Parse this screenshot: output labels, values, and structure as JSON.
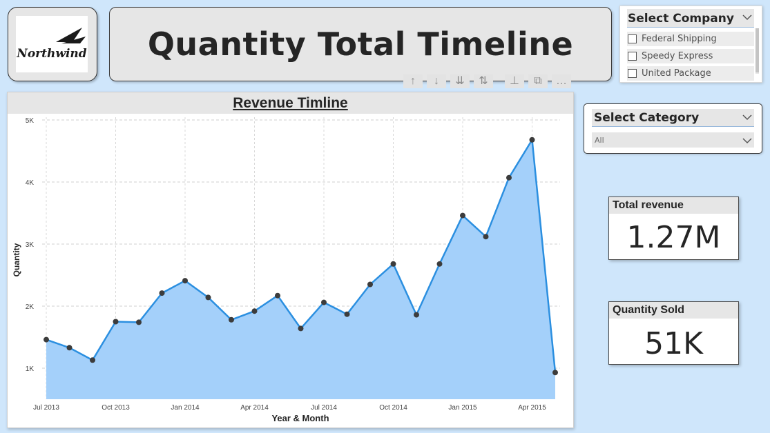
{
  "logo": {
    "text": "Northwind"
  },
  "header": {
    "title": "Quantity Total Timeline"
  },
  "company_slicer": {
    "title": "Select Company",
    "items": [
      {
        "label": "Federal Shipping",
        "checked": false
      },
      {
        "label": "Speedy Express",
        "checked": false
      },
      {
        "label": "United Package",
        "checked": false
      }
    ]
  },
  "category_slicer": {
    "title": "Select Category",
    "selected": "All"
  },
  "cards": {
    "total_revenue": {
      "label": "Total revenue",
      "value": "1.27M"
    },
    "quantity_sold": {
      "label": "Quantity Sold",
      "value": "51K"
    }
  },
  "chart_toolbar": {
    "icons": [
      "drill-up-icon",
      "drill-down-icon",
      "expand-next-level-icon",
      "expand-all-icon",
      "pin-icon",
      "focus-mode-icon",
      "more-options-icon"
    ]
  },
  "colors": {
    "background": "#cfe6fb",
    "area_fill": "#a4d0fa",
    "line": "#2b8fe0",
    "marker": "#3c3c3c"
  },
  "chart_data": {
    "type": "area",
    "title": "Revenue Timline",
    "xlabel": "Year & Month",
    "ylabel": "Quantity",
    "x": [
      "Jul 2013",
      "Aug 2013",
      "Sep 2013",
      "Oct 2013",
      "Nov 2013",
      "Dec 2013",
      "Jan 2014",
      "Feb 2014",
      "Mar 2014",
      "Apr 2014",
      "May 2014",
      "Jun 2014",
      "Jul 2014",
      "Aug 2014",
      "Sep 2014",
      "Oct 2014",
      "Nov 2014",
      "Dec 2014",
      "Jan 2015",
      "Feb 2015",
      "Mar 2015",
      "Apr 2015",
      "May 2015"
    ],
    "series": [
      {
        "values": [
          1460,
          1330,
          1130,
          1750,
          1740,
          2210,
          2410,
          2140,
          1780,
          1920,
          2170,
          1640,
          2060,
          1870,
          2350,
          2680,
          1860,
          2680,
          3460,
          3120,
          4070,
          4680,
          930
        ]
      }
    ],
    "xtick_labels": [
      "Jul 2013",
      "Oct 2013",
      "Jan 2014",
      "Apr 2014",
      "Jul 2014",
      "Oct 2014",
      "Jan 2015",
      "Apr 2015"
    ],
    "xtick_index": [
      0,
      3,
      6,
      9,
      12,
      15,
      18,
      21
    ],
    "yticks": [
      1000,
      2000,
      3000,
      4000,
      5000
    ],
    "ytick_labels": [
      "1K",
      "2K",
      "3K",
      "4K",
      "5K"
    ],
    "ylim": [
      500,
      5000
    ],
    "grid": true,
    "legend": "none"
  }
}
